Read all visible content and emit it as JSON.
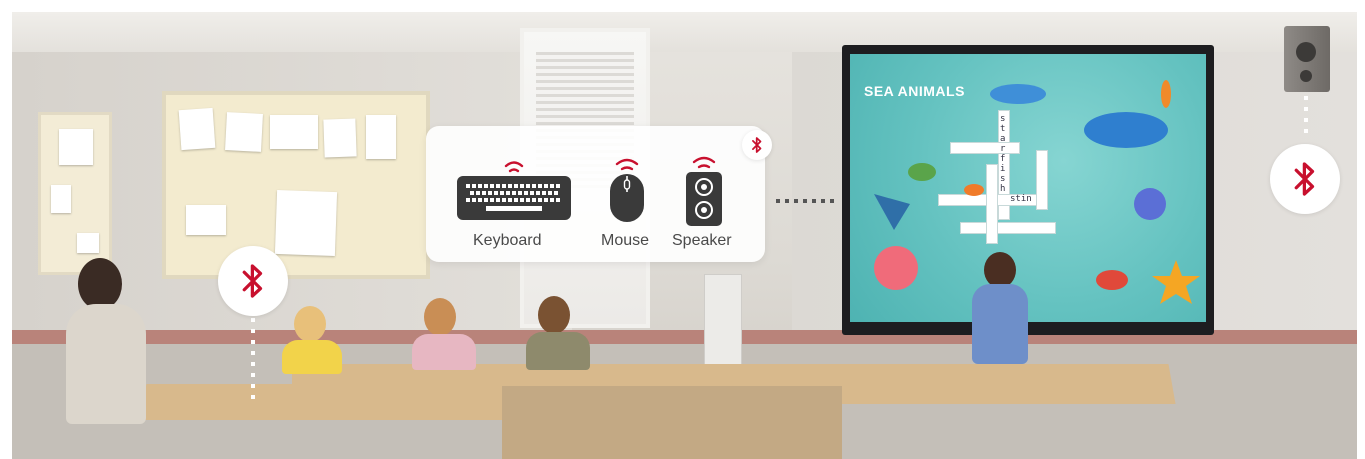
{
  "devices": [
    {
      "label": "Keyboard",
      "icon": "keyboard-icon"
    },
    {
      "label": "Mouse",
      "icon": "mouse-icon"
    },
    {
      "label": "Speaker",
      "icon": "speaker-icon"
    }
  ],
  "screen": {
    "title": "SEA ANIMALS",
    "crossword_vertical": "starfish",
    "crossword_horizontal": "stin"
  },
  "colors": {
    "accent": "#c8102e",
    "panel_bg": "#ffffff",
    "label_text": "#4a4a4a",
    "screen_bg": "#64c2c0"
  },
  "bluetooth_badges": [
    "bluetooth-icon",
    "bluetooth-icon",
    "bluetooth-icon",
    "bluetooth-icon"
  ]
}
